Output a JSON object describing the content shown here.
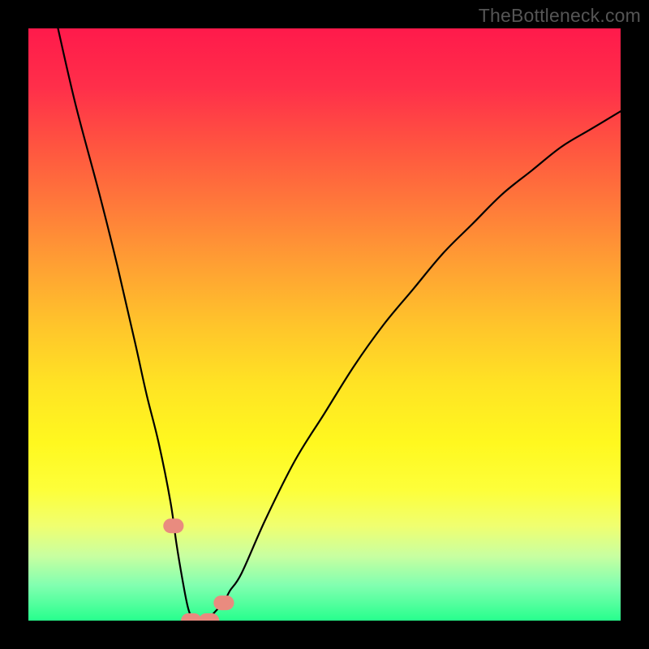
{
  "watermark": "TheBottleneck.com",
  "chart_data": {
    "type": "line",
    "title": "",
    "xlabel": "",
    "ylabel": "",
    "xlim": [
      0,
      100
    ],
    "ylim": [
      0,
      100
    ],
    "series": [
      {
        "name": "bottleneck-curve",
        "x": [
          5,
          8,
          12,
          15,
          18,
          20,
          22,
          24,
          25,
          26,
          27,
          28,
          29,
          30,
          32,
          33,
          34,
          36,
          40,
          45,
          50,
          55,
          60,
          65,
          70,
          75,
          80,
          85,
          90,
          95,
          100
        ],
        "values": [
          100,
          87,
          72,
          60,
          47,
          38,
          30,
          20,
          13,
          7,
          2,
          0,
          0,
          0,
          2,
          3,
          5,
          8,
          17,
          27,
          35,
          43,
          50,
          56,
          62,
          67,
          72,
          76,
          80,
          83,
          86
        ]
      }
    ],
    "markers": [
      {
        "name": "marker-left-shoulder",
        "x": 24.5,
        "y": 16
      },
      {
        "name": "marker-right-shoulder",
        "x": 33.0,
        "y": 3
      },
      {
        "name": "marker-trough-left",
        "x": 27.5,
        "y": 0
      },
      {
        "name": "marker-trough-right",
        "x": 30.5,
        "y": 0
      }
    ],
    "gradient": {
      "description": "vertical rainbow gradient red→green encoding bottleneck severity",
      "stops": [
        {
          "pos": 0,
          "color": "#ff1a4b"
        },
        {
          "pos": 50,
          "color": "#ffc42b"
        },
        {
          "pos": 78,
          "color": "#fdff3a"
        },
        {
          "pos": 100,
          "color": "#27ff8d"
        }
      ]
    }
  }
}
